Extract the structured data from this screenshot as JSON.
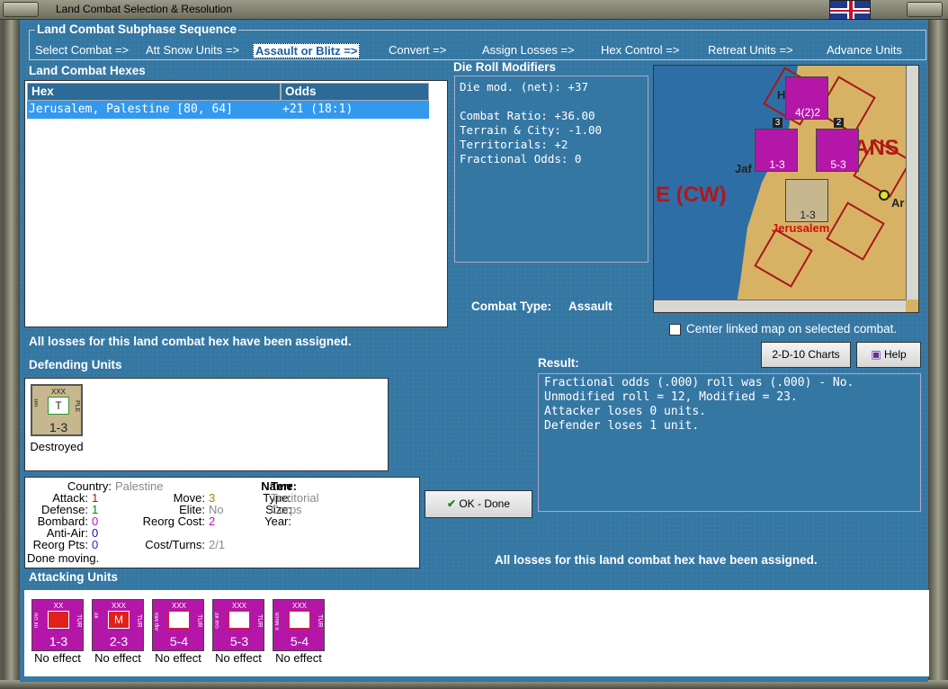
{
  "window": {
    "title": "Land Combat Selection & Resolution"
  },
  "subphase": {
    "title": "Land Combat Subphase Sequence",
    "steps": [
      "Select Combat =>",
      "Att Snow Units =>",
      "Assault or Blitz =>",
      "Convert =>",
      "Assign Losses =>",
      "Hex Control =>",
      "Retreat Units =>",
      "Advance Units"
    ]
  },
  "hexes": {
    "title": "Land Combat Hexes",
    "col_hex": "Hex",
    "col_odds": "Odds",
    "rows": [
      {
        "hex": "Jerusalem, Palestine [80, 64]",
        "odds": "+21 (18:1)"
      }
    ]
  },
  "drm": {
    "title": "Die Roll Modifiers",
    "lines": [
      "Die mod. (net): +37",
      "",
      "Combat Ratio: +36.00",
      "Terrain & City: -1.00",
      "Territorials: +2",
      "Fractional Odds: 0"
    ]
  },
  "map": {
    "label_cw": "E (CW)",
    "label_jerusalem": "Jerusalem",
    "label_jaf": "Jaf",
    "label_ans": "ANS",
    "label_h": "H",
    "label_a": "A",
    "label_ar": "Ar",
    "stack1": "3",
    "stack2": "2",
    "c1_str": "4(2)2",
    "c2_str": "1-3",
    "c3_str": "5-3",
    "c4_str": "1-3"
  },
  "combat_type": {
    "label": "Combat Type:",
    "value": "Assault"
  },
  "center_map": {
    "label": "Center linked map on selected combat.",
    "checked": false
  },
  "losses_msg": "All losses for this land combat hex have been assigned.",
  "buttons": {
    "charts": "2-D-10 Charts",
    "help": "Help",
    "ok": "OK - Done"
  },
  "defending": {
    "title": "Defending Units",
    "units": [
      {
        "size": "XXX",
        "type": "Terr",
        "nat": "PLE",
        "sym": "T",
        "strength": "1-3",
        "result": "Destroyed"
      }
    ]
  },
  "result": {
    "title": "Result:",
    "lines": [
      "Fractional odds (.000) roll was (.000)  - No.",
      "Unmodified roll = 12, Modified = 23.",
      "Attacker loses 0 units.",
      "Defender loses 1 unit."
    ]
  },
  "info": {
    "country_k": "Country:",
    "country_v": "Palestine",
    "attack_k": "Attack:",
    "attack_v": "1",
    "defense_k": "Defense:",
    "defense_v": "1",
    "bombard_k": "Bombard:",
    "bombard_v": "0",
    "antiair_k": "Anti-Air:",
    "antiair_v": "0",
    "reorg_k": "Reorg Pts:",
    "reorg_v": "0",
    "done": "Done moving.",
    "move_k": "Move:",
    "move_v": "3",
    "elite_k": "Elite:",
    "elite_v": "No",
    "reorgcost_k": "Reorg Cost:",
    "reorgcost_v": "2",
    "cost_k": "Cost/Turns:",
    "cost_v": "2/1",
    "name_k": "Name:",
    "name_v": "Terr",
    "type_k": "Type:",
    "type_v": "Territorial",
    "size_k": "Size:",
    "size_v": "Corps",
    "year_k": "Year:"
  },
  "attacking": {
    "title": "Attacking Units",
    "units": [
      {
        "size": "XX",
        "type": "Inf Div",
        "nat": "TUR",
        "sym": "",
        "strength": "1-3",
        "result": "No effect"
      },
      {
        "size": "XXX",
        "type": "Inf",
        "nat": "TUR",
        "sym": "M",
        "strength": "2-3",
        "result": "No effect"
      },
      {
        "size": "XXX",
        "type": "Alp Mtn",
        "nat": "TUR",
        "sym": "",
        "strength": "5-4",
        "result": "No effect"
      },
      {
        "size": "XXX",
        "type": "Gal Inf",
        "nat": "TUR",
        "sym": "",
        "strength": "5-3",
        "result": "No effect"
      },
      {
        "size": "XXX",
        "type": "II Mech",
        "nat": "TUR",
        "sym": "",
        "strength": "5-4",
        "result": "No effect"
      }
    ]
  },
  "colors": {
    "panel": "#3577a3",
    "turk": "#b416a8",
    "palestine": "#c6b78f",
    "selected": "#3399ee"
  }
}
